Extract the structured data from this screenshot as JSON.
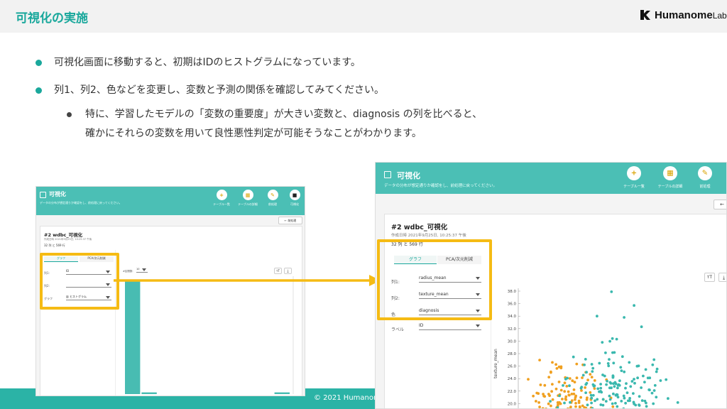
{
  "slide": {
    "title": "可視化の実施",
    "logo_text": "Humanome",
    "logo_suffix": "Lab",
    "bullets": [
      "可視化画面に移動すると、初期はIDのヒストグラムになっています。",
      "列1、列2、色などを変更し、変数と予測の関係を確認してみてください。"
    ],
    "sub_bullet_lines": [
      "特に、学習したモデルの「変数の重要度」が大きい変数と、diagnosis の列を比べると、",
      "確かにそれらの変数を用いて良性悪性判定が可能そうなことがわかります。"
    ],
    "copyright": "© 2021 Humanom"
  },
  "left_app": {
    "title": "可視化",
    "subtitle": "データの分布が想定通りか確認をし、前処理に戻ってください。",
    "steps": [
      "テーブル一覧",
      "テーブルの詳細",
      "前処理",
      "可視化"
    ],
    "back_label": "前処理",
    "card_title": "#2 wdbc_可視化",
    "created": "作成日時 2021年9月25日, 10:25:37 午後",
    "dims": "32 列 と 569 行",
    "tabs": [
      "グラフ",
      "PCA/次元削減"
    ],
    "fields": [
      {
        "label": "列1:",
        "value": "ID"
      },
      {
        "label": "列2:",
        "value": ""
      },
      {
        "label": "グラフ",
        "value": "ヒストグラム"
      }
    ],
    "bins_label": "#区間数:",
    "bins_value": "10",
    "histogram": [
      100,
      1.5,
      0,
      0,
      0,
      0,
      0,
      0,
      0,
      1.5
    ]
  },
  "right_app": {
    "title": "可視化",
    "subtitle": "データの分布が想定通りか確認をし、前処理に戻ってください。",
    "steps": [
      "テーブル一覧",
      "テーブルの詳細",
      "前処理"
    ],
    "card_title": "#2 wdbc_可視化",
    "created": "作成日時 2021年9月25日, 10:25:37 午後",
    "dims": "32 列 と 569 行",
    "tabs": [
      "グラフ",
      "PCA/次元削減"
    ],
    "fields": [
      {
        "label": "列1:",
        "value": "radius_mean"
      },
      {
        "label": "列2:",
        "value": "texture_mean"
      },
      {
        "label": "色",
        "value": "diagnosis"
      },
      {
        "label": "ラベル",
        "value": "ID"
      }
    ]
  },
  "chart_data": {
    "type": "scatter",
    "ylabel": "texture_mean",
    "yticks": [
      "38.0",
      "36.0",
      "34.0",
      "32.0",
      "30.0",
      "28.0",
      "26.0",
      "24.0",
      "22.0",
      "20.0",
      "18.0"
    ],
    "ylim": [
      18,
      38
    ],
    "series": [
      {
        "color": "#f0a020"
      },
      {
        "color": "#3ab8ae"
      }
    ]
  },
  "colors": {
    "accent": "#1aa89c",
    "highlight": "#f5bb14",
    "app_header": "#4bbfb5"
  }
}
